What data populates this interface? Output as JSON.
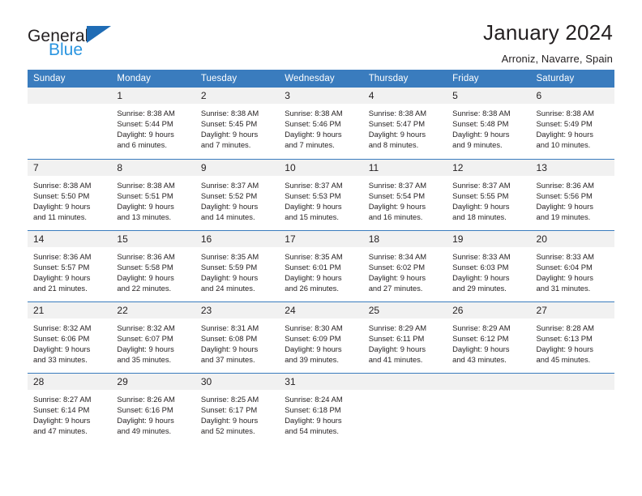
{
  "brand": {
    "name_part1": "General",
    "name_part2": "Blue",
    "triangle_color": "#1f6cb5",
    "blue_text_color": "#2a95e0"
  },
  "header": {
    "title": "January 2024",
    "subtitle": "Arroniz, Navarre, Spain"
  },
  "theme": {
    "header_band": "#3a7cbe",
    "daynum_band": "#f1f1f1",
    "text": "#231f20"
  },
  "weekday_headers": [
    "Sunday",
    "Monday",
    "Tuesday",
    "Wednesday",
    "Thursday",
    "Friday",
    "Saturday"
  ],
  "weeks": [
    [
      {
        "day": "",
        "sunrise": "",
        "sunset": "",
        "daylight_line1": "",
        "daylight_line2": ""
      },
      {
        "day": "1",
        "sunrise": "Sunrise: 8:38 AM",
        "sunset": "Sunset: 5:44 PM",
        "daylight_line1": "Daylight: 9 hours",
        "daylight_line2": "and 6 minutes."
      },
      {
        "day": "2",
        "sunrise": "Sunrise: 8:38 AM",
        "sunset": "Sunset: 5:45 PM",
        "daylight_line1": "Daylight: 9 hours",
        "daylight_line2": "and 7 minutes."
      },
      {
        "day": "3",
        "sunrise": "Sunrise: 8:38 AM",
        "sunset": "Sunset: 5:46 PM",
        "daylight_line1": "Daylight: 9 hours",
        "daylight_line2": "and 7 minutes."
      },
      {
        "day": "4",
        "sunrise": "Sunrise: 8:38 AM",
        "sunset": "Sunset: 5:47 PM",
        "daylight_line1": "Daylight: 9 hours",
        "daylight_line2": "and 8 minutes."
      },
      {
        "day": "5",
        "sunrise": "Sunrise: 8:38 AM",
        "sunset": "Sunset: 5:48 PM",
        "daylight_line1": "Daylight: 9 hours",
        "daylight_line2": "and 9 minutes."
      },
      {
        "day": "6",
        "sunrise": "Sunrise: 8:38 AM",
        "sunset": "Sunset: 5:49 PM",
        "daylight_line1": "Daylight: 9 hours",
        "daylight_line2": "and 10 minutes."
      }
    ],
    [
      {
        "day": "7",
        "sunrise": "Sunrise: 8:38 AM",
        "sunset": "Sunset: 5:50 PM",
        "daylight_line1": "Daylight: 9 hours",
        "daylight_line2": "and 11 minutes."
      },
      {
        "day": "8",
        "sunrise": "Sunrise: 8:38 AM",
        "sunset": "Sunset: 5:51 PM",
        "daylight_line1": "Daylight: 9 hours",
        "daylight_line2": "and 13 minutes."
      },
      {
        "day": "9",
        "sunrise": "Sunrise: 8:37 AM",
        "sunset": "Sunset: 5:52 PM",
        "daylight_line1": "Daylight: 9 hours",
        "daylight_line2": "and 14 minutes."
      },
      {
        "day": "10",
        "sunrise": "Sunrise: 8:37 AM",
        "sunset": "Sunset: 5:53 PM",
        "daylight_line1": "Daylight: 9 hours",
        "daylight_line2": "and 15 minutes."
      },
      {
        "day": "11",
        "sunrise": "Sunrise: 8:37 AM",
        "sunset": "Sunset: 5:54 PM",
        "daylight_line1": "Daylight: 9 hours",
        "daylight_line2": "and 16 minutes."
      },
      {
        "day": "12",
        "sunrise": "Sunrise: 8:37 AM",
        "sunset": "Sunset: 5:55 PM",
        "daylight_line1": "Daylight: 9 hours",
        "daylight_line2": "and 18 minutes."
      },
      {
        "day": "13",
        "sunrise": "Sunrise: 8:36 AM",
        "sunset": "Sunset: 5:56 PM",
        "daylight_line1": "Daylight: 9 hours",
        "daylight_line2": "and 19 minutes."
      }
    ],
    [
      {
        "day": "14",
        "sunrise": "Sunrise: 8:36 AM",
        "sunset": "Sunset: 5:57 PM",
        "daylight_line1": "Daylight: 9 hours",
        "daylight_line2": "and 21 minutes."
      },
      {
        "day": "15",
        "sunrise": "Sunrise: 8:36 AM",
        "sunset": "Sunset: 5:58 PM",
        "daylight_line1": "Daylight: 9 hours",
        "daylight_line2": "and 22 minutes."
      },
      {
        "day": "16",
        "sunrise": "Sunrise: 8:35 AM",
        "sunset": "Sunset: 5:59 PM",
        "daylight_line1": "Daylight: 9 hours",
        "daylight_line2": "and 24 minutes."
      },
      {
        "day": "17",
        "sunrise": "Sunrise: 8:35 AM",
        "sunset": "Sunset: 6:01 PM",
        "daylight_line1": "Daylight: 9 hours",
        "daylight_line2": "and 26 minutes."
      },
      {
        "day": "18",
        "sunrise": "Sunrise: 8:34 AM",
        "sunset": "Sunset: 6:02 PM",
        "daylight_line1": "Daylight: 9 hours",
        "daylight_line2": "and 27 minutes."
      },
      {
        "day": "19",
        "sunrise": "Sunrise: 8:33 AM",
        "sunset": "Sunset: 6:03 PM",
        "daylight_line1": "Daylight: 9 hours",
        "daylight_line2": "and 29 minutes."
      },
      {
        "day": "20",
        "sunrise": "Sunrise: 8:33 AM",
        "sunset": "Sunset: 6:04 PM",
        "daylight_line1": "Daylight: 9 hours",
        "daylight_line2": "and 31 minutes."
      }
    ],
    [
      {
        "day": "21",
        "sunrise": "Sunrise: 8:32 AM",
        "sunset": "Sunset: 6:06 PM",
        "daylight_line1": "Daylight: 9 hours",
        "daylight_line2": "and 33 minutes."
      },
      {
        "day": "22",
        "sunrise": "Sunrise: 8:32 AM",
        "sunset": "Sunset: 6:07 PM",
        "daylight_line1": "Daylight: 9 hours",
        "daylight_line2": "and 35 minutes."
      },
      {
        "day": "23",
        "sunrise": "Sunrise: 8:31 AM",
        "sunset": "Sunset: 6:08 PM",
        "daylight_line1": "Daylight: 9 hours",
        "daylight_line2": "and 37 minutes."
      },
      {
        "day": "24",
        "sunrise": "Sunrise: 8:30 AM",
        "sunset": "Sunset: 6:09 PM",
        "daylight_line1": "Daylight: 9 hours",
        "daylight_line2": "and 39 minutes."
      },
      {
        "day": "25",
        "sunrise": "Sunrise: 8:29 AM",
        "sunset": "Sunset: 6:11 PM",
        "daylight_line1": "Daylight: 9 hours",
        "daylight_line2": "and 41 minutes."
      },
      {
        "day": "26",
        "sunrise": "Sunrise: 8:29 AM",
        "sunset": "Sunset: 6:12 PM",
        "daylight_line1": "Daylight: 9 hours",
        "daylight_line2": "and 43 minutes."
      },
      {
        "day": "27",
        "sunrise": "Sunrise: 8:28 AM",
        "sunset": "Sunset: 6:13 PM",
        "daylight_line1": "Daylight: 9 hours",
        "daylight_line2": "and 45 minutes."
      }
    ],
    [
      {
        "day": "28",
        "sunrise": "Sunrise: 8:27 AM",
        "sunset": "Sunset: 6:14 PM",
        "daylight_line1": "Daylight: 9 hours",
        "daylight_line2": "and 47 minutes."
      },
      {
        "day": "29",
        "sunrise": "Sunrise: 8:26 AM",
        "sunset": "Sunset: 6:16 PM",
        "daylight_line1": "Daylight: 9 hours",
        "daylight_line2": "and 49 minutes."
      },
      {
        "day": "30",
        "sunrise": "Sunrise: 8:25 AM",
        "sunset": "Sunset: 6:17 PM",
        "daylight_line1": "Daylight: 9 hours",
        "daylight_line2": "and 52 minutes."
      },
      {
        "day": "31",
        "sunrise": "Sunrise: 8:24 AM",
        "sunset": "Sunset: 6:18 PM",
        "daylight_line1": "Daylight: 9 hours",
        "daylight_line2": "and 54 minutes."
      },
      {
        "day": "",
        "sunrise": "",
        "sunset": "",
        "daylight_line1": "",
        "daylight_line2": ""
      },
      {
        "day": "",
        "sunrise": "",
        "sunset": "",
        "daylight_line1": "",
        "daylight_line2": ""
      },
      {
        "day": "",
        "sunrise": "",
        "sunset": "",
        "daylight_line1": "",
        "daylight_line2": ""
      }
    ]
  ]
}
